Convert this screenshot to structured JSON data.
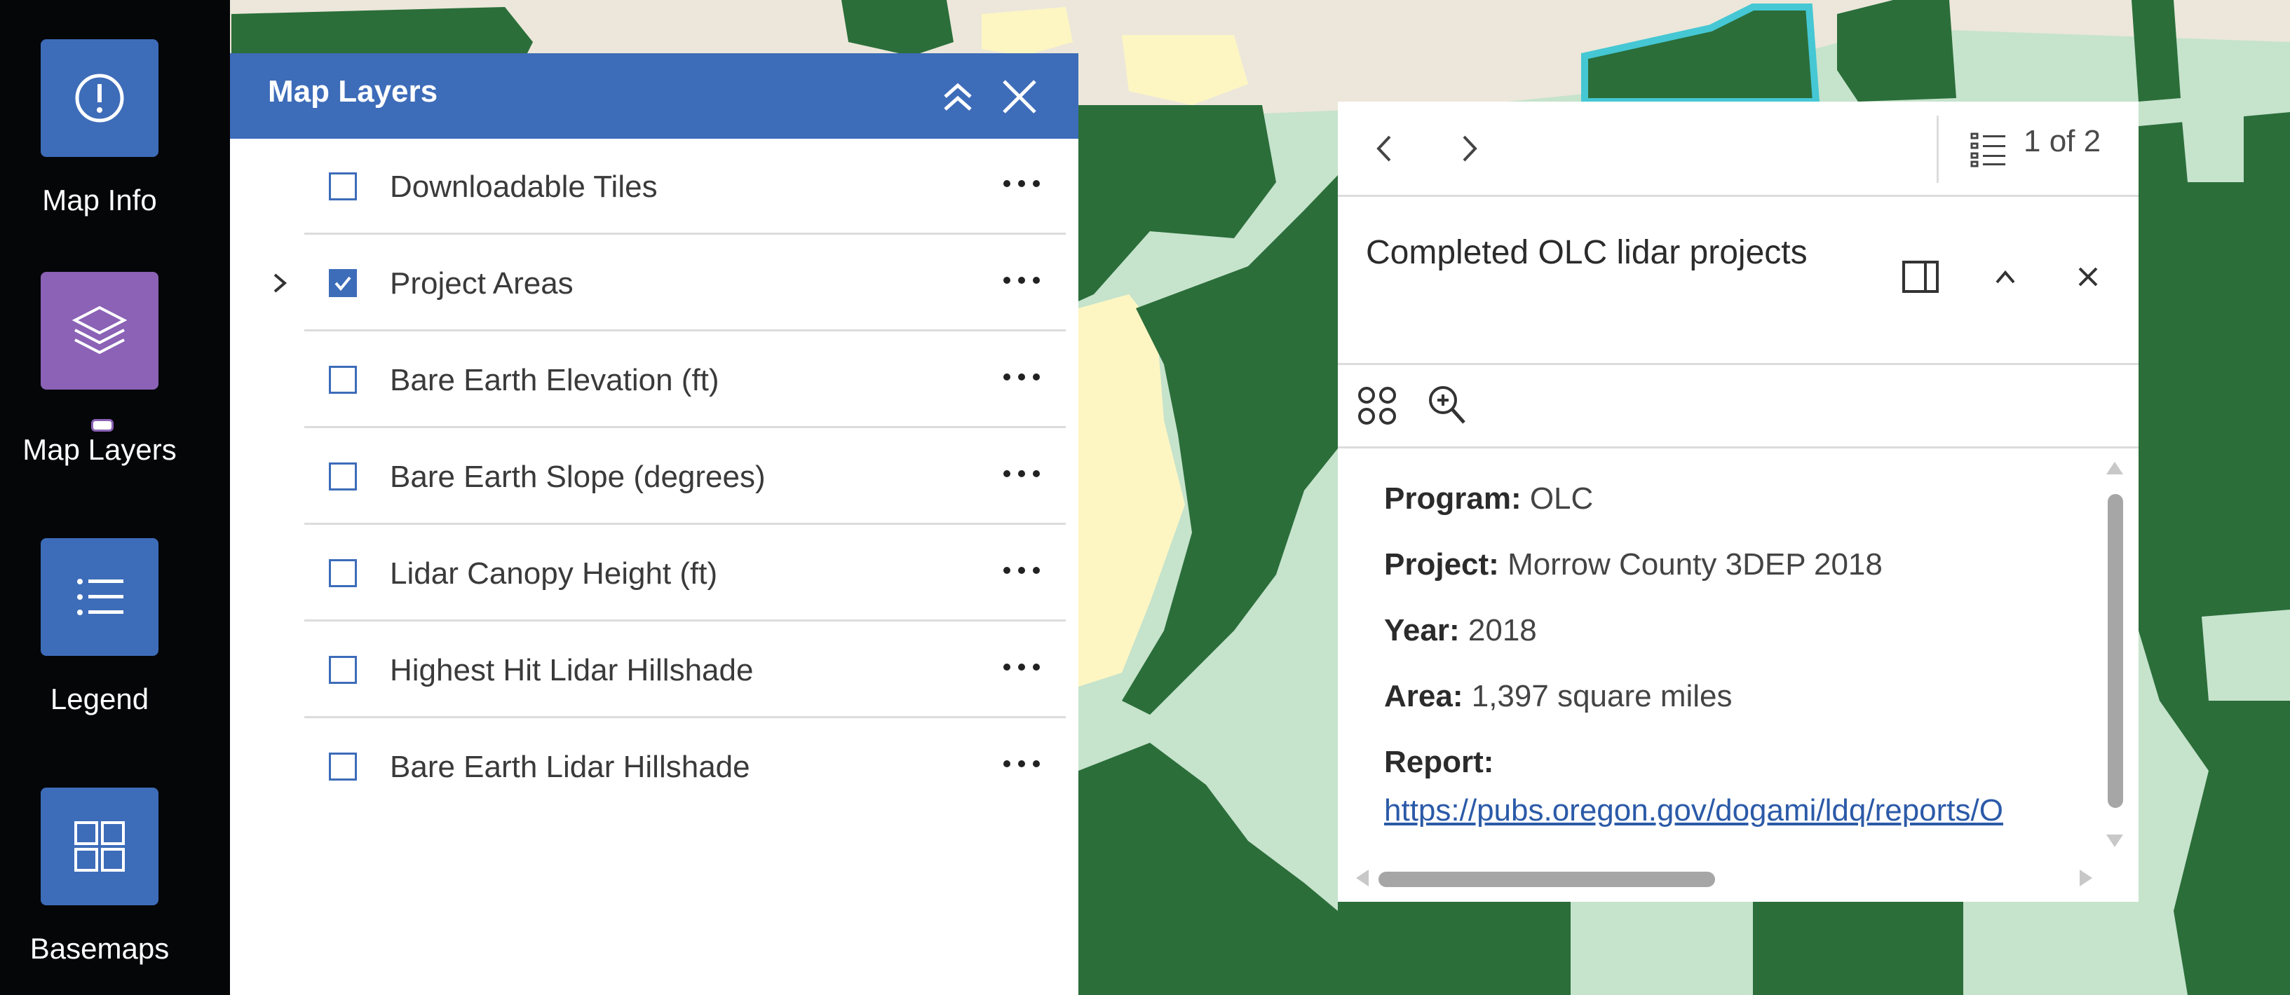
{
  "colors": {
    "dark_green": "#2b6e3a",
    "light_green": "#c6e3cc",
    "yellow": "#fdf6c3",
    "beige": "#ece7da",
    "panel_blue": "#3d6cb9",
    "map_layers_purple": "#8b62b5",
    "highlight_cyan": "#45c7d4"
  },
  "sidebar": {
    "map_info_label": "Map Info",
    "map_layers_label": "Map Layers",
    "legend_label": "Legend",
    "basemaps_label": "Basemaps"
  },
  "layers_panel": {
    "title": "Map Layers",
    "layers": [
      {
        "name": "Downloadable Tiles",
        "checked": false
      },
      {
        "name": "Project Areas",
        "checked": true
      },
      {
        "name": "Bare Earth Elevation (ft)",
        "checked": false
      },
      {
        "name": "Bare Earth Slope (degrees)",
        "checked": false
      },
      {
        "name": "Lidar Canopy Height (ft)",
        "checked": false
      },
      {
        "name": "Highest Hit Lidar Hillshade",
        "checked": false
      },
      {
        "name": "Bare Earth Lidar Hillshade",
        "checked": false
      }
    ]
  },
  "popup": {
    "page_count": "1 of 2",
    "title": "Completed OLC lidar projects",
    "program_label": "Program:",
    "program_value": "OLC",
    "project_label": "Project:",
    "project_value": "Morrow County 3DEP 2018",
    "year_label": "Year:",
    "year_value": "2018",
    "area_label": "Area:",
    "area_value": "1,397 square miles",
    "report_label": "Report:",
    "report_url": "https://pubs.oregon.gov/dogami/ldq/reports/O"
  }
}
